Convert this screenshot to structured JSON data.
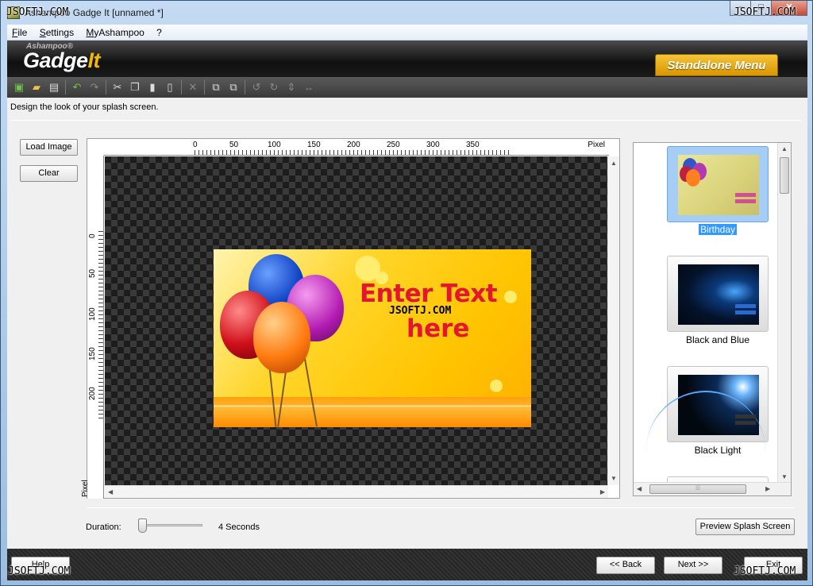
{
  "window": {
    "title": "Ashampoo Gadge It [unnamed *]",
    "minimize": "–",
    "maximize": "□",
    "close": "✕"
  },
  "menu": [
    "File",
    "Settings",
    "MyAshampoo",
    "?"
  ],
  "header": {
    "brand_small": "Ashampoo®",
    "logo_a": "Gadge",
    "logo_b": "It",
    "standalone_menu": "Standalone Menu"
  },
  "toolbar_icons": [
    "new-icon",
    "open-icon",
    "save-icon",
    "undo-icon",
    "redo-icon",
    "cut-icon",
    "copy-icon",
    "paste-icon",
    "duplicate-icon",
    "delete-icon",
    "bring-front-icon",
    "send-back-icon",
    "rotate-left-icon",
    "rotate-right-icon",
    "flip-vertical-icon",
    "flip-horizontal-icon"
  ],
  "description": "Design the look of your splash screen.",
  "buttons": {
    "load_image": "Load Image",
    "clear": "Clear",
    "preview": "Preview Splash Screen",
    "help": "Help",
    "back": "<< Back",
    "next": "Next >>",
    "exit": "Exit"
  },
  "ruler": {
    "unit": "Pixel",
    "top_ticks": [
      "0",
      "50",
      "100",
      "150",
      "200",
      "250",
      "300",
      "350"
    ],
    "left_ticks": [
      "0",
      "50",
      "100",
      "150",
      "200"
    ]
  },
  "splash": {
    "line1": "Enter Text",
    "line2": "here"
  },
  "templates": [
    {
      "name": "Birthday",
      "selected": true
    },
    {
      "name": "Black and Blue",
      "selected": false
    },
    {
      "name": "Black Light",
      "selected": false
    }
  ],
  "duration": {
    "label": "Duration:",
    "value": "4 Seconds"
  },
  "watermark": "JSOFTJ.COM",
  "colors": {
    "accent": "#f0b800",
    "selection": "#3399ff",
    "splash_text": "#e3152f"
  }
}
